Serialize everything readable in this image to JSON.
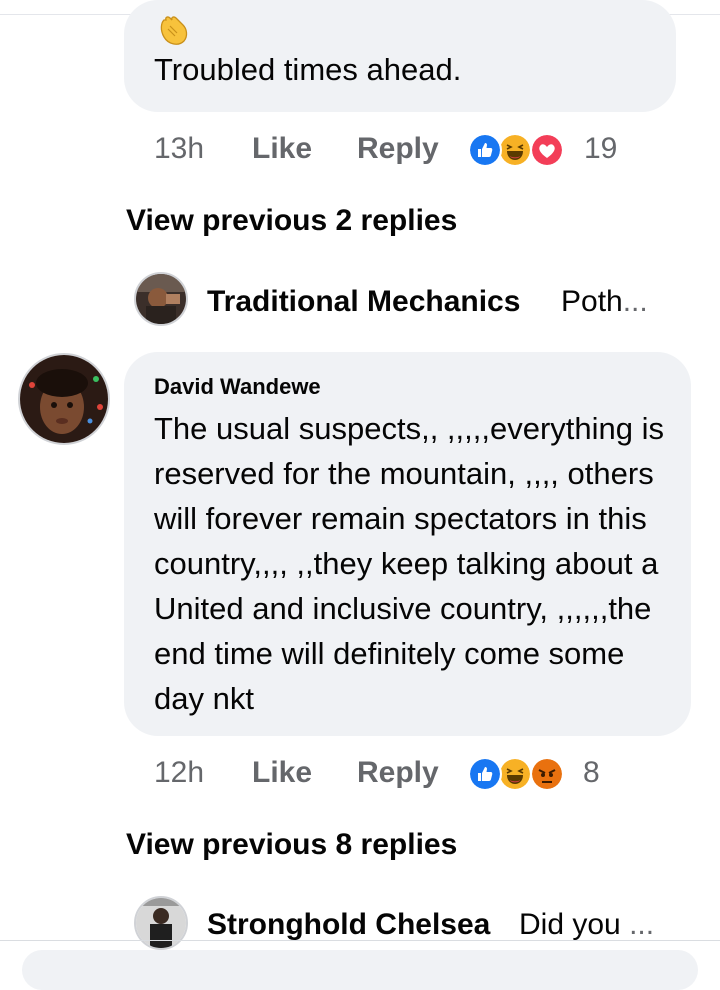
{
  "comment1": {
    "emoji": "clapping-hands-emoji",
    "text": "Troubled times ahead.",
    "time": "13h",
    "like": "Like",
    "reply": "Reply",
    "reactions": [
      "like",
      "haha",
      "love"
    ],
    "reaction_count": "19",
    "view_previous": "View previous 2 replies",
    "reply_preview": {
      "name": "Traditional Mechanics",
      "snippet": "Poth",
      "ellipsis": "..."
    }
  },
  "comment2": {
    "author": "David Wandewe",
    "text": "The usual suspects,, ,,,,,everything is reserved for the mountain, ,,,, others will forever remain spectators in this country,,,, ,,they keep talking about a United and inclusive country, ,,,,,,the end time will definitely come some day nkt",
    "time": "12h",
    "like": "Like",
    "reply": "Reply",
    "reactions": [
      "like",
      "haha",
      "angry"
    ],
    "reaction_count": "8",
    "view_previous": "View previous 8 replies",
    "reply_preview": {
      "name": "Stronghold Chelsea",
      "snippet": "Did you",
      "ellipsis": "..."
    }
  },
  "colors": {
    "bubble": "#f0f2f5",
    "meta_text": "#65676b",
    "like_blue": "#1877f2",
    "haha_yellow": "#f7b125",
    "love_red": "#f33e58",
    "angry_orange": "#e9710f"
  }
}
